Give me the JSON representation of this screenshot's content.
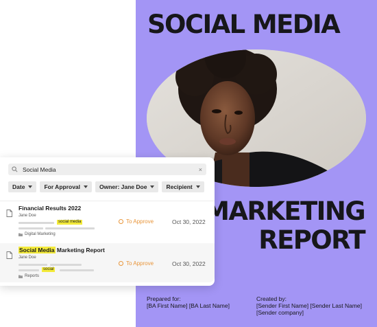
{
  "cover": {
    "title": "SOCIAL MEDIA",
    "subtitle_line1": "MARKETING",
    "subtitle_line2": "REPORT",
    "prepared_label": "Prepared for:",
    "prepared_value": "[BA First Name] [BA Last Name]",
    "created_label": "Created by:",
    "created_line1": "[Sender First Name] [Sender Last Name]",
    "created_line2": "[Sender company]",
    "accent_color": "#a395f5"
  },
  "search": {
    "query": "Social Media",
    "clear_icon": "×"
  },
  "filters": [
    {
      "label": "Date"
    },
    {
      "label": "For Approval"
    },
    {
      "label": "Owner: Jane Doe"
    },
    {
      "label": "Recipient"
    }
  ],
  "results": [
    {
      "title": "Financial Results 2022",
      "owner": "Jane Doe",
      "tag": "social media",
      "folder": "Digital Marketing",
      "status": "To Approve",
      "date": "Oct 30, 2022"
    },
    {
      "title_highlight": "Social Media",
      "title_rest": "Marketing Report",
      "owner": "Jane Doe",
      "tag": "social",
      "folder": "Reports",
      "status": "To Approve",
      "date": "Oct 30, 2022"
    }
  ],
  "colors": {
    "status_orange": "#e8953a",
    "highlight_yellow": "#f3ea3a"
  }
}
